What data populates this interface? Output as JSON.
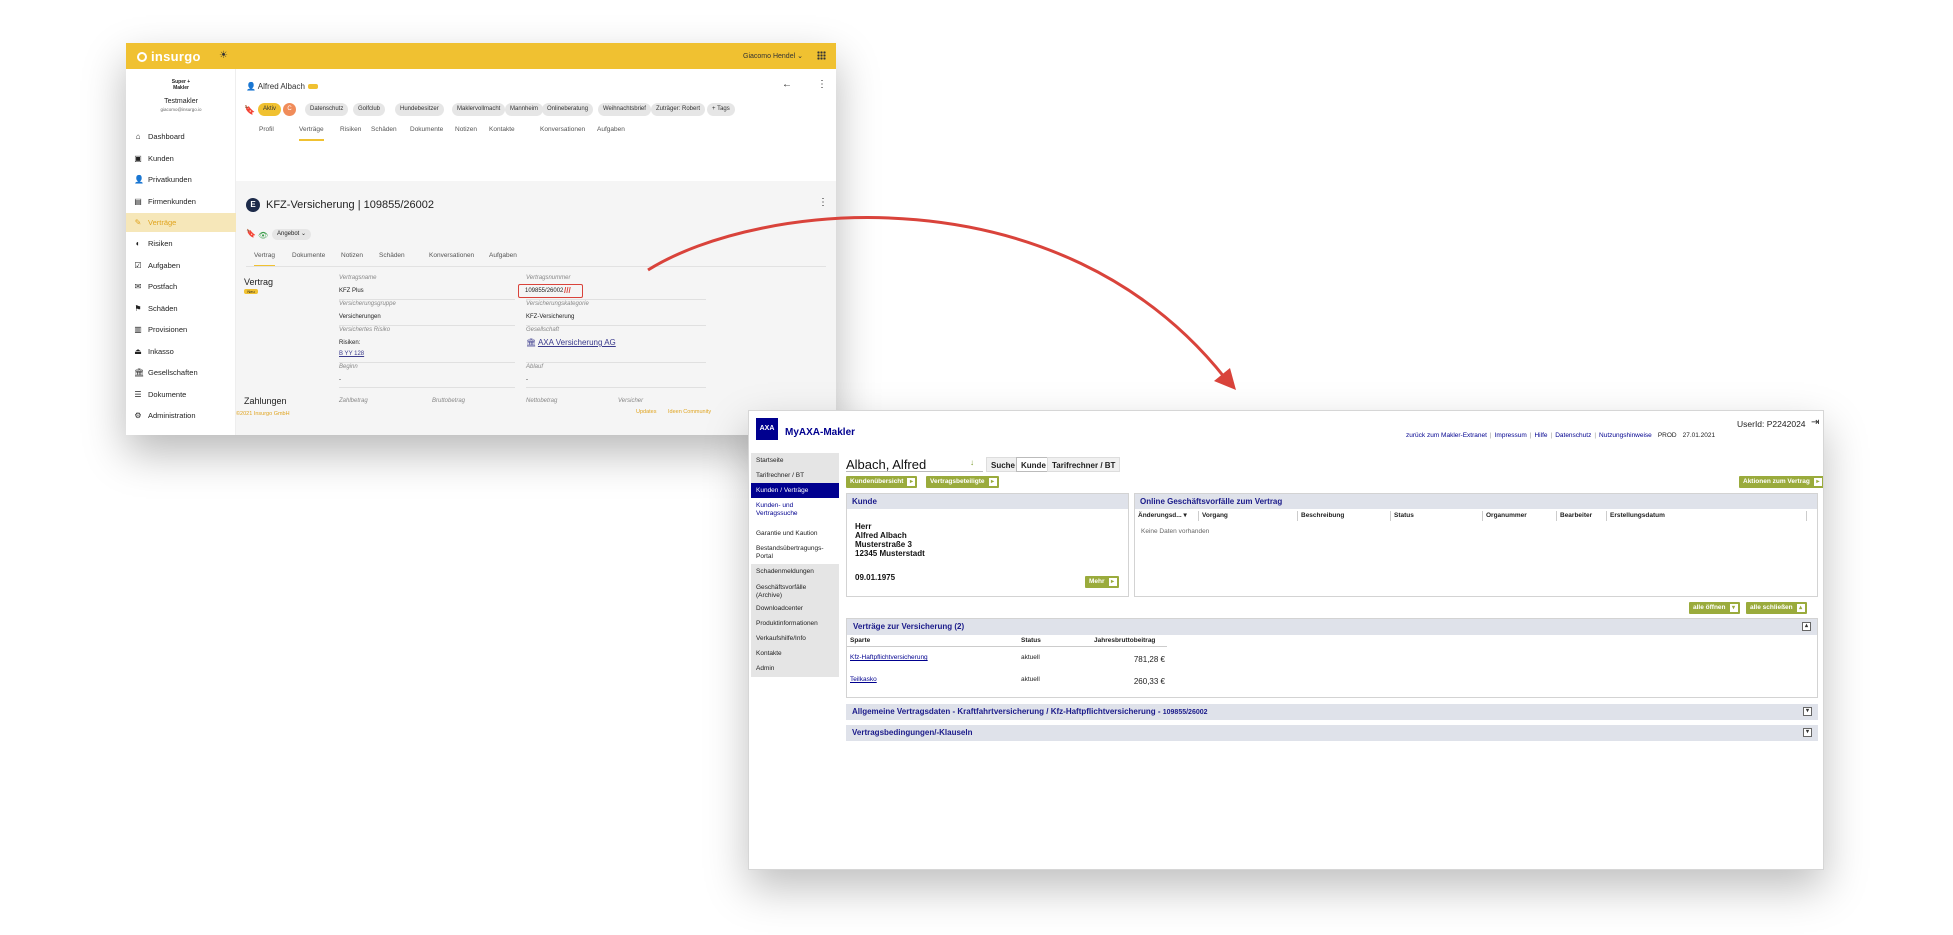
{
  "insurgo": {
    "logo": "insurgo",
    "user": "Giacomo Hendel",
    "brand_line1": "Super +",
    "brand_line2": "Makler",
    "org": "Testmakler",
    "email": "giacomo@insurgo.io",
    "nav": [
      "Dashboard",
      "Kunden",
      "Privatkunden",
      "Firmenkunden",
      "Verträge",
      "Risiken",
      "Aufgaben",
      "Postfach",
      "Schäden",
      "Provisionen",
      "Inkasso",
      "Gesellschaften",
      "Dokumente",
      "Administration"
    ],
    "nav_active_index": 4,
    "person": "Alfred Albach",
    "tags": [
      "Aktiv",
      "C",
      "Datenschutz",
      "Golfclub",
      "Hundebesitzer",
      "Maklervollmacht",
      "Mannheim",
      "Onlineberatung",
      "Weihnachtsbrief",
      "Zuträger: Robert",
      "+ Tags"
    ],
    "customer_tabs": [
      "Profil",
      "Verträge",
      "Risiken",
      "Schäden",
      "Dokumente",
      "Notizen",
      "Kontakte",
      "Konversationen",
      "Aufgaben"
    ],
    "customer_tab_active": 1,
    "contract_badge": "E",
    "contract_title": "KFZ-Versicherung | 109855/26002",
    "angebot": "Angebot",
    "contract_tabs": [
      "Vertrag",
      "Dokumente",
      "Notizen",
      "Schäden",
      "Konversationen",
      "Aufgaben"
    ],
    "contract_tab_active": 0,
    "section_vertrag": "Vertrag",
    "neu_badge": "Neu",
    "fields": {
      "vertragsname_label": "Vertragsname",
      "vertragsname": "KFZ Plus",
      "vertragsnummer_label": "Vertragsnummer",
      "vertragsnummer": "109855/26002",
      "versicherungsgruppe_label": "Versicherungsgruppe",
      "versicherungsgruppe": "Versicherungen",
      "versicherungskategorie_label": "Versicherungskategorie",
      "versicherungskategorie": "KFZ-Versicherung",
      "risiko_label": "Versichertes Risiko",
      "risiko_prefix": "Risiken:",
      "risiko_value": "B YY 128",
      "gesellschaft_label": "Gesellschaft",
      "gesellschaft": "AXA Versicherung AG",
      "beginn_label": "Beginn",
      "beginn": "-",
      "ablauf_label": "Ablauf",
      "ablauf": "-"
    },
    "section_zahlungen": "Zahlungen",
    "zahl_cols": [
      "Zahlbetrag",
      "Bruttobetrag",
      "Nettobetrag",
      "Versicher"
    ],
    "footer_left": "©2021 Insurgo GmbH",
    "footer_links": [
      "Updates",
      "Ideen Community"
    ]
  },
  "axa": {
    "logo": "AXA",
    "title": "MyAXA-Makler",
    "userid": "UserId: P2242024",
    "links": [
      "zurück zum Makler-Extranet",
      "Impressum",
      "Hilfe",
      "Datenschutz",
      "Nutzungshinweise"
    ],
    "env": "PROD",
    "date": "27.01.2021",
    "nav": [
      "Startseite",
      "Tarifrechner / BT",
      "Kunden / Verträge",
      "Kunden- und Vertragssuche",
      "Garantie und Kaution",
      "Bestandsübertragungs-Portal",
      "Schadenmeldungen",
      "Geschäftsvorfälle (Archive)",
      "Downloadcenter",
      "Produktinformationen",
      "Verkaufshilfe/Info",
      "Kontakte",
      "Admin"
    ],
    "customer_name": "Albach, Alfred",
    "top_buttons": [
      "Suche",
      "Kunde",
      "Tarifrechner / BT"
    ],
    "btn_kundenuebersicht": "Kundenübersicht",
    "btn_vertragsbeteiligte": "Vertragsbeteiligte",
    "btn_aktionen": "Aktionen zum Vertrag",
    "kunde_header": "Kunde",
    "kunde": {
      "anrede": "Herr",
      "name": "Alfred Albach",
      "strasse": "Musterstraße 3",
      "ort": "12345 Musterstadt",
      "geburtsdatum": "09.01.1975"
    },
    "btn_mehr": "Mehr",
    "online_header": "Online Geschäftsvorfälle zum Vertrag",
    "online_cols": [
      "Änderungsd... ▾",
      "Vorgang",
      "Beschreibung",
      "Status",
      "Organummer",
      "Bearbeiter",
      "Erstellungsdatum"
    ],
    "online_empty": "Keine Daten vorhanden",
    "btn_alle_oeffnen": "alle öffnen",
    "btn_alle_schliessen": "alle schließen",
    "vertraege_header": "Verträge zur Versicherung (2)",
    "vt_cols": [
      "Sparte",
      "Status",
      "Jahresbruttobeitrag"
    ],
    "vt_rows": [
      {
        "sparte": "Kfz-Haftpflichtversicherung",
        "status": "aktuell",
        "beitrag": "781,28 €"
      },
      {
        "sparte": "Teilkasko",
        "status": "aktuell",
        "beitrag": "260,33 €"
      }
    ],
    "allgemein_header": "Allgemeine Vertragsdaten - Kraftfahrtversicherung / Kfz-Haftpflichtversicherung -",
    "allgemein_nr": "109855/26002",
    "bedingungen_header": "Vertragsbedingungen/-Klauseln"
  },
  "colors": {
    "insurgo_yellow": "#f0c131",
    "axa_blue": "#00008f",
    "axa_green": "#9aab3c",
    "arrow_red": "#d9433b"
  }
}
